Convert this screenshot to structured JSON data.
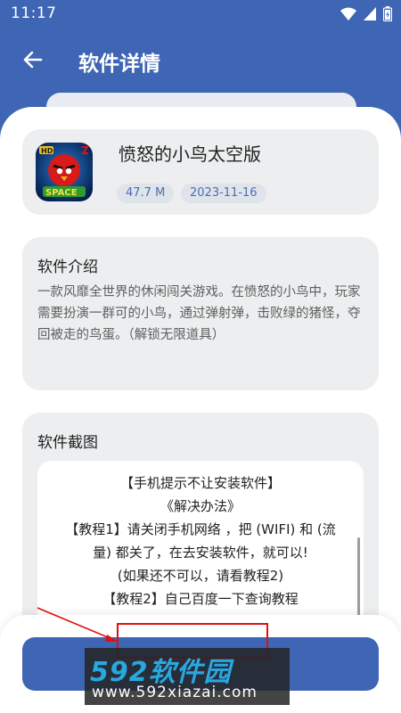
{
  "status": {
    "time": "11:17"
  },
  "appbar": {
    "title": "软件详情",
    "back_icon": "arrow-left-icon"
  },
  "app": {
    "name": "愤怒的小鸟太空版",
    "size": "47.7 M",
    "date": "2023-11-16",
    "icon": "angry-birds-space-icon"
  },
  "intro": {
    "title": "软件介绍",
    "text": "一款风靡全世界的休闲闯关游戏。在愤怒的小鸟中，玩家需要扮演一群可的小鸟，通过弹射弹，击败绿的猪怪，夺回被走的鸟蛋。（解锁无限道具）"
  },
  "screenshots": {
    "title": "软件截图",
    "lines": [
      "【手机提示不让安装软件】",
      "《解决办法》",
      "【教程1】请关闭手机网络 ，把 (WIFI) 和 (流",
      "量) 都关了，在去安装软件，就可以!",
      "(如果还不可以，请看教程2)",
      "【教程2】自己百度一下查询教程"
    ]
  },
  "watermark": {
    "logo": "592软件园",
    "url": "www.592xiazai.com"
  },
  "colors": {
    "primary": "#3f66b5",
    "card": "#eceeef",
    "chip_text": "#4c6fb6",
    "annotation": "#e01010"
  }
}
